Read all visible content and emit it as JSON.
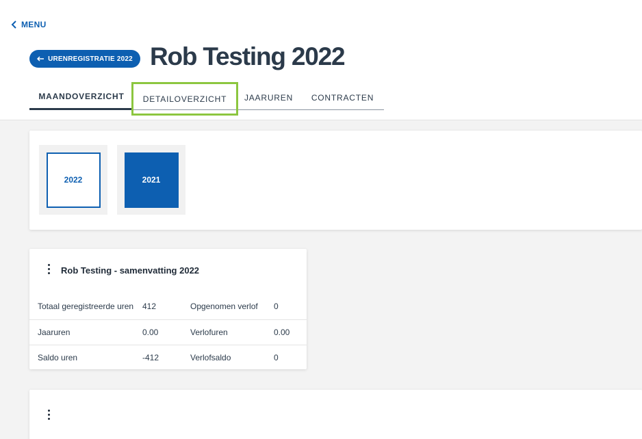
{
  "nav": {
    "menu_label": "MENU"
  },
  "header": {
    "back_label": "URENREGISTRATIE 2022",
    "title": "Rob Testing 2022"
  },
  "tabs": [
    {
      "label": "MAANDOVERZICHT",
      "active": true
    },
    {
      "label": "DETAILOVERZICHT",
      "highlighted": true
    },
    {
      "label": "JAARUREN"
    },
    {
      "label": "CONTRACTEN"
    }
  ],
  "years": [
    {
      "label": "2022",
      "selected": false
    },
    {
      "label": "2021",
      "selected": true
    }
  ],
  "summary": {
    "title": "Rob Testing - samenvatting 2022",
    "rows": [
      {
        "label": "Totaal geregistreerde uren",
        "value": "412",
        "label2": "Opgenomen verlof",
        "value2": "0"
      },
      {
        "label": "Jaaruren",
        "value": "0.00",
        "label2": "Verlofuren",
        "value2": "0.00"
      },
      {
        "label": "Saldo uren",
        "value": "-412",
        "label2": "Verlofsaldo",
        "value2": "0"
      }
    ]
  },
  "colors": {
    "primary": "#0d5fb1",
    "highlight_outline": "#8cc63f",
    "title_text": "#2b3a4a",
    "background": "#f3f3f3"
  },
  "icons": {
    "menu_back": "chevron-left-icon",
    "back_button": "arrow-left-icon",
    "card_menu": "kebab-menu-icon"
  }
}
